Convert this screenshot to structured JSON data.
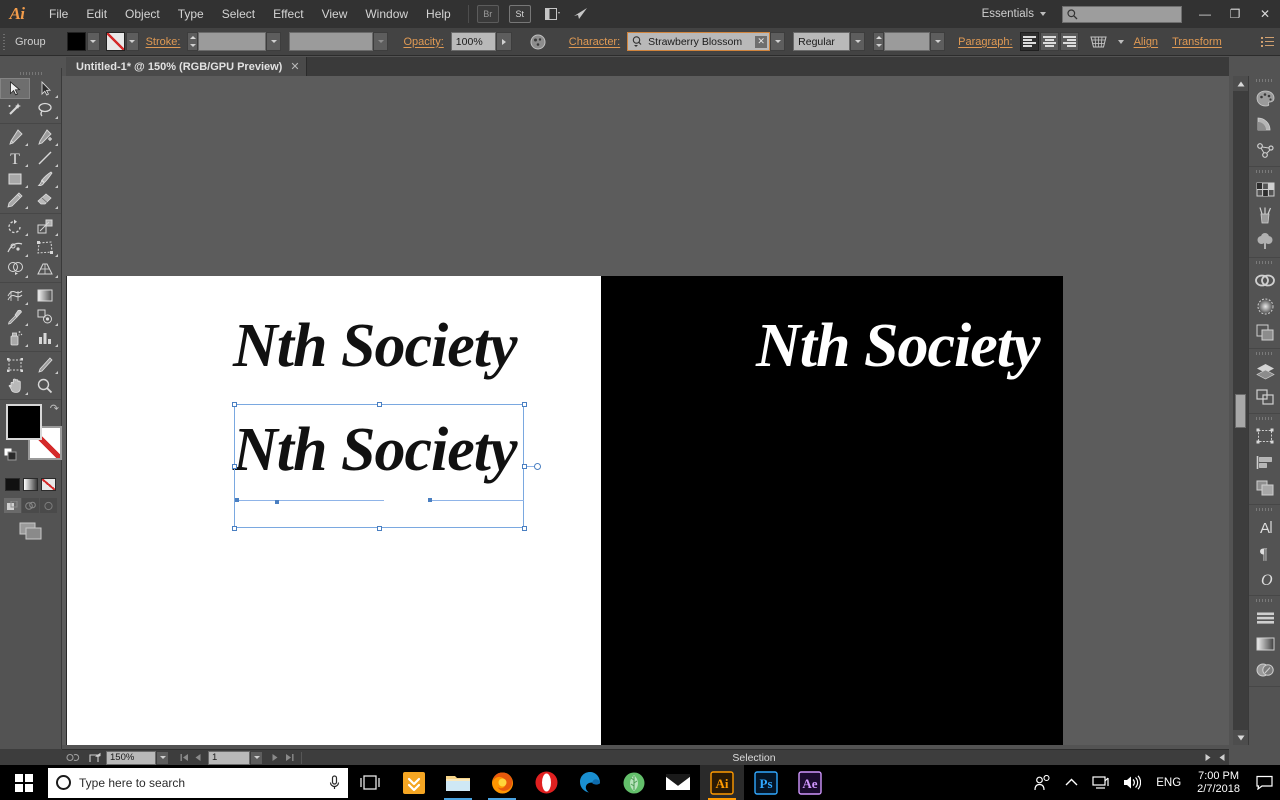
{
  "app": {
    "name": "Adobe Illustrator",
    "logo": "Ai"
  },
  "menubar": {
    "items": [
      "File",
      "Edit",
      "Object",
      "Type",
      "Select",
      "Effect",
      "View",
      "Window",
      "Help"
    ],
    "bridge_label": "Br",
    "stock_label": "St",
    "workspace": "Essentials",
    "search_placeholder": "",
    "window_controls": {
      "minimize": "—",
      "restore": "❐",
      "close": "✕"
    }
  },
  "controlbar": {
    "selection_label": "Group",
    "fill_color": "#000000",
    "stroke_label": "Stroke:",
    "stroke_weight": "",
    "stroke_profile": "",
    "opacity_label": "Opacity:",
    "opacity_value": "100%",
    "character_label": "Character:",
    "font_family": "Strawberry Blossom",
    "font_style": "Regular",
    "font_size": "",
    "paragraph_label": "Paragraph:",
    "align_label": "Align",
    "transform_label": "Transform"
  },
  "document": {
    "tab_title": "Untitled-1* @ 150% (RGB/GPU Preview)",
    "close_glyph": "✕"
  },
  "toolbar": {
    "groups": [
      [
        {
          "name": "selection-tool",
          "selected": true
        },
        {
          "name": "direct-selection-tool",
          "selected": false
        },
        {
          "name": "magic-wand-tool",
          "selected": false
        },
        {
          "name": "lasso-tool",
          "selected": false
        }
      ],
      [
        {
          "name": "pen-tool",
          "selected": false
        },
        {
          "name": "add-anchor-point-tool",
          "selected": false
        },
        {
          "name": "type-tool",
          "selected": false
        },
        {
          "name": "line-segment-tool",
          "selected": false
        },
        {
          "name": "rectangle-tool",
          "selected": false
        },
        {
          "name": "paintbrush-tool",
          "selected": false
        },
        {
          "name": "pencil-tool",
          "selected": false
        },
        {
          "name": "eraser-tool",
          "selected": false
        }
      ],
      [
        {
          "name": "rotate-tool",
          "selected": false
        },
        {
          "name": "scale-tool",
          "selected": false
        },
        {
          "name": "width-tool",
          "selected": false
        },
        {
          "name": "free-transform-tool",
          "selected": false
        },
        {
          "name": "shape-builder-tool",
          "selected": false
        },
        {
          "name": "perspective-grid-tool",
          "selected": false
        }
      ],
      [
        {
          "name": "mesh-tool",
          "selected": false
        },
        {
          "name": "gradient-tool",
          "selected": false
        },
        {
          "name": "eyedropper-tool",
          "selected": false
        },
        {
          "name": "blend-tool",
          "selected": false
        },
        {
          "name": "symbol-sprayer-tool",
          "selected": false
        },
        {
          "name": "column-graph-tool",
          "selected": false
        }
      ],
      [
        {
          "name": "artboard-tool",
          "selected": false
        },
        {
          "name": "slice-tool",
          "selected": false
        },
        {
          "name": "hand-tool",
          "selected": false
        },
        {
          "name": "zoom-tool",
          "selected": false
        }
      ]
    ],
    "fill_color": "#000000",
    "stroke_color": "none",
    "mini_swatches": [
      "#000000",
      "gradient",
      "none"
    ],
    "draw_modes": [
      "draw-normal",
      "draw-behind",
      "draw-inside"
    ],
    "screen_mode": "change-screen-mode"
  },
  "dock": {
    "groups": [
      [
        "color-panel-icon",
        "color-guide-panel-icon",
        "recolor-artwork-icon"
      ],
      [
        "swatches-panel-icon",
        "brushes-panel-icon",
        "symbols-panel-icon"
      ],
      [
        "stroke-panel-icon",
        "gradient-panel-icon",
        "transparency-panel-icon"
      ],
      [
        "layers-panel-icon",
        "artboards-panel-icon"
      ],
      [
        "transform-panel-icon",
        "align-panel-icon",
        "pathfinder-panel-icon"
      ],
      [
        "character-panel-icon",
        "paragraph-panel-icon",
        "glyphs-panel-icon"
      ],
      [
        "appearance-panel-icon",
        "graphic-styles-panel-icon",
        "image-trace-panel-icon"
      ]
    ]
  },
  "canvas": {
    "artwork": {
      "line_top": "Nth  Society",
      "line_bottom": "Nth  Society",
      "inverted": "Nth  Society",
      "text_color_left": "#000000",
      "text_color_right": "#ffffff",
      "artboard_left_bg": "#ffffff",
      "artboard_right_bg": "#000000"
    }
  },
  "statusbar": {
    "zoom": "150%",
    "page": "1",
    "status": "Selection",
    "first_glyph": "⏮",
    "prev_glyph": "◀",
    "next_glyph": "▶",
    "last_glyph": "⏭"
  },
  "taskbar": {
    "search_placeholder": "Type here to search",
    "apps": [
      {
        "name": "task-view",
        "label": ""
      },
      {
        "name": "downloads-app",
        "label": ""
      },
      {
        "name": "file-explorer",
        "label": ""
      },
      {
        "name": "firefox",
        "label": ""
      },
      {
        "name": "opera",
        "label": ""
      },
      {
        "name": "microsoft-edge",
        "label": ""
      },
      {
        "name": "green-app",
        "label": ""
      },
      {
        "name": "mail",
        "label": ""
      },
      {
        "name": "adobe-illustrator",
        "label": "Ai",
        "active": true
      },
      {
        "name": "adobe-photoshop",
        "label": "Ps",
        "active": false
      },
      {
        "name": "adobe-after-effects",
        "label": "Ae",
        "active": false
      }
    ],
    "tray": {
      "language": "ENG",
      "time": "7:00 PM",
      "date": "2/7/2018"
    }
  }
}
